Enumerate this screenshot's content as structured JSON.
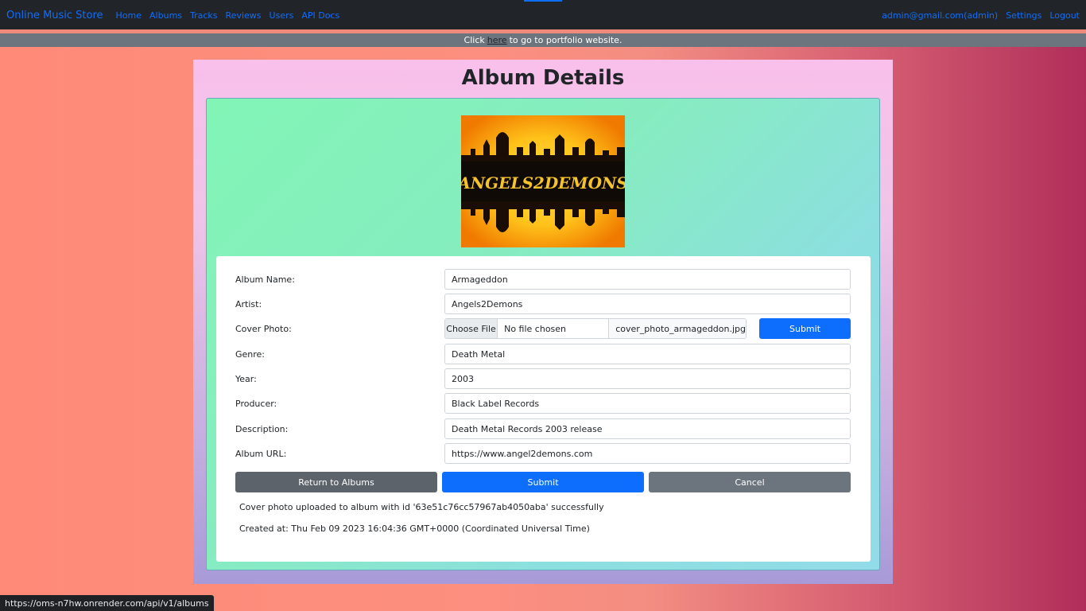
{
  "navbar": {
    "brand": "Online Music Store",
    "links": [
      "Home",
      "Albums",
      "Tracks",
      "Reviews",
      "Users",
      "API Docs"
    ],
    "user": "admin@gmail.com(admin)",
    "settings": "Settings",
    "logout": "Logout"
  },
  "banner": {
    "before": "Click",
    "link": "here",
    "after": "to go to portfolio website."
  },
  "page": {
    "title": "Album Details"
  },
  "cover": {
    "text": "ANGELS2DEMONS"
  },
  "form": {
    "album_name_label": "Album Name:",
    "album_name_value": "Armageddon",
    "artist_label": "Artist:",
    "artist_value": "Angels2Demons",
    "cover_label": "Cover Photo:",
    "choose_file": "Choose File",
    "no_file": "No file chosen",
    "current_file": "cover_photo_armageddon.jpg",
    "cover_submit": "Submit",
    "genre_label": "Genre:",
    "genre_value": "Death Metal",
    "year_label": "Year:",
    "year_value": "2003",
    "producer_label": "Producer:",
    "producer_value": "Black Label Records",
    "description_label": "Description:",
    "description_value": "Death Metal Records 2003 release",
    "url_label": "Album URL:",
    "url_value": "https://www.angel2demons.com"
  },
  "actions": {
    "return": "Return to Albums",
    "submit": "Submit",
    "cancel": "Cancel"
  },
  "messages": {
    "upload": "Cover photo uploaded to album with id '63e51c76cc57967ab4050aba' successfully",
    "created": "Created at: Thu Feb 09 2023 16:04:36 GMT+0000 (Coordinated Universal Time)"
  },
  "status_bar": {
    "url": "https://oms-n7hw.onrender.com/api/v1/albums"
  }
}
